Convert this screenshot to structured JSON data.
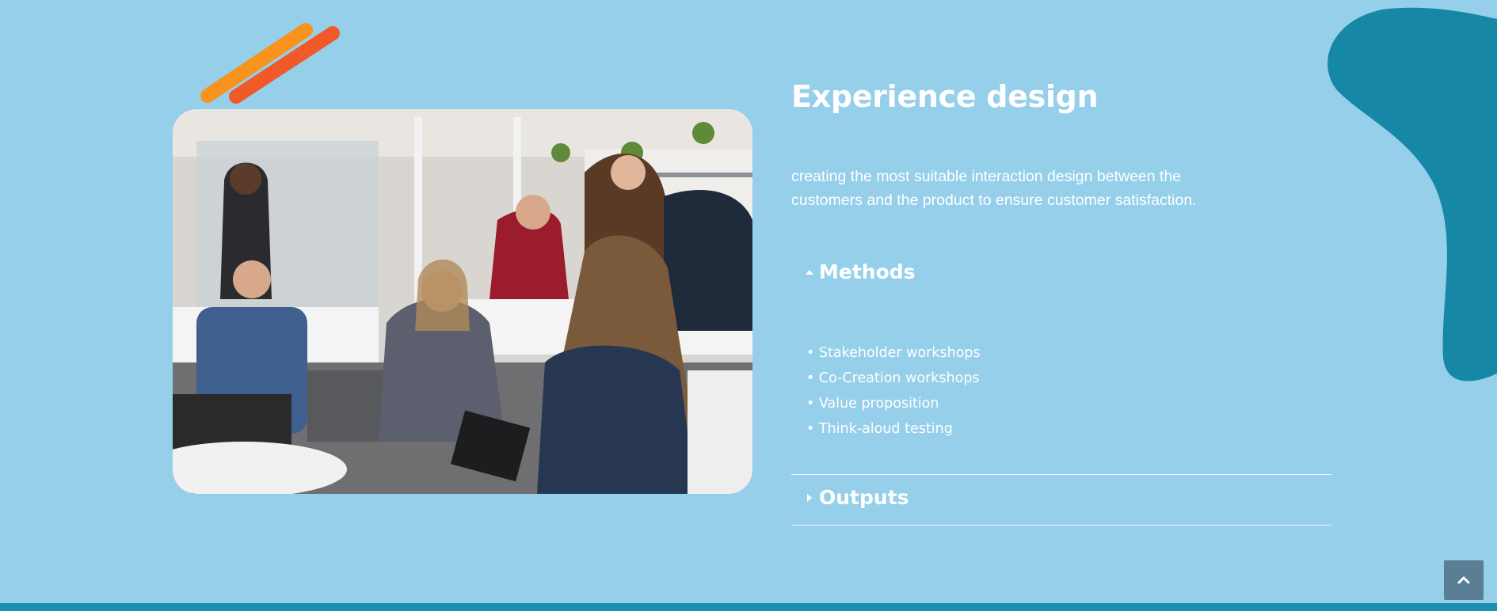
{
  "section": {
    "title": "Experience design",
    "description": "creating the most suitable interaction design between the customers and the product to ensure customer satisfaction."
  },
  "accordion": [
    {
      "label": "Methods",
      "expanded": true,
      "items": [
        "Stakeholder workshops",
        "Co-Creation workshops",
        "Value proposition",
        "Think-aloud testing"
      ]
    },
    {
      "label": "Outputs",
      "expanded": false,
      "items": []
    }
  ],
  "icons": {
    "expanded_caret": "caret-up-icon",
    "collapsed_caret": "caret-right-icon",
    "scroll_top": "chevron-up-icon"
  },
  "colors": {
    "background": "#95cfea",
    "blob": "#1787a6",
    "stripe_orange": "#f7931e",
    "stripe_red": "#ef5a28",
    "scroll_button": "#5a7f94",
    "bottom_bar": "#1d8fb5"
  }
}
